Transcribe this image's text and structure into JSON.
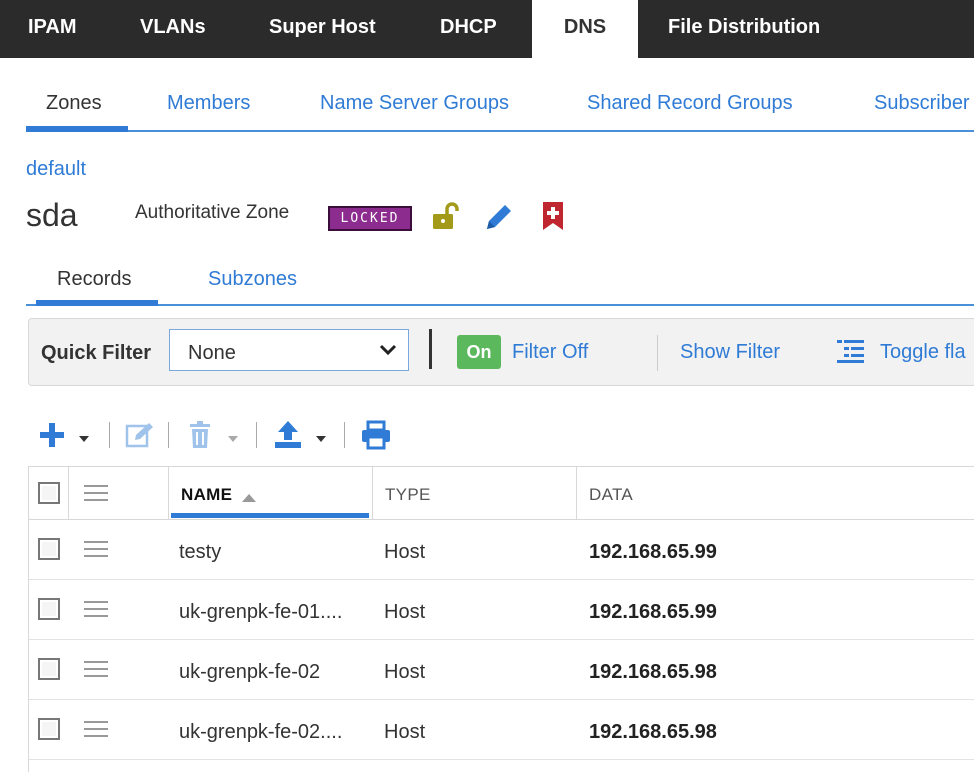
{
  "topnav": {
    "tabs": [
      "IPAM",
      "VLANs",
      "Super Host",
      "DHCP",
      "DNS",
      "File Distribution"
    ],
    "active": "DNS"
  },
  "subnav": {
    "tabs": [
      "Zones",
      "Members",
      "Name Server Groups",
      "Shared Record Groups",
      "Subscriber"
    ],
    "active": "Zones"
  },
  "zone": {
    "breadcrumb": "default",
    "name": "sda",
    "type": "Authoritative Zone",
    "lock_badge": "LOCKED"
  },
  "record_tabs": {
    "tabs": [
      "Records",
      "Subzones"
    ],
    "active": "Records"
  },
  "filter_bar": {
    "label": "Quick Filter",
    "selected": "None",
    "toggle_label": "On",
    "filter_off": "Filter Off",
    "show_filter": "Show Filter",
    "toggle_flat": "Toggle fla"
  },
  "grid": {
    "columns": [
      "NAME",
      "TYPE",
      "DATA"
    ],
    "sorted_column": "NAME",
    "rows": [
      {
        "name": "testy",
        "type": "Host",
        "data": "192.168.65.99"
      },
      {
        "name": "uk-grenpk-fe-01....",
        "type": "Host",
        "data": "192.168.65.99"
      },
      {
        "name": "uk-grenpk-fe-02",
        "type": "Host",
        "data": "192.168.65.98"
      },
      {
        "name": "uk-grenpk-fe-02....",
        "type": "Host",
        "data": "192.168.65.98"
      }
    ]
  },
  "colors": {
    "nav_bg": "#2b2b2b",
    "link_blue": "#2f7bd6",
    "lock_badge": "#8b2c8e",
    "on_green": "#5cb85c"
  },
  "icons": [
    "unlock-icon",
    "pencil-icon",
    "bookmark-icon",
    "add-icon",
    "edit-icon",
    "trash-icon",
    "export-icon",
    "print-icon",
    "toggle-list-icon"
  ]
}
